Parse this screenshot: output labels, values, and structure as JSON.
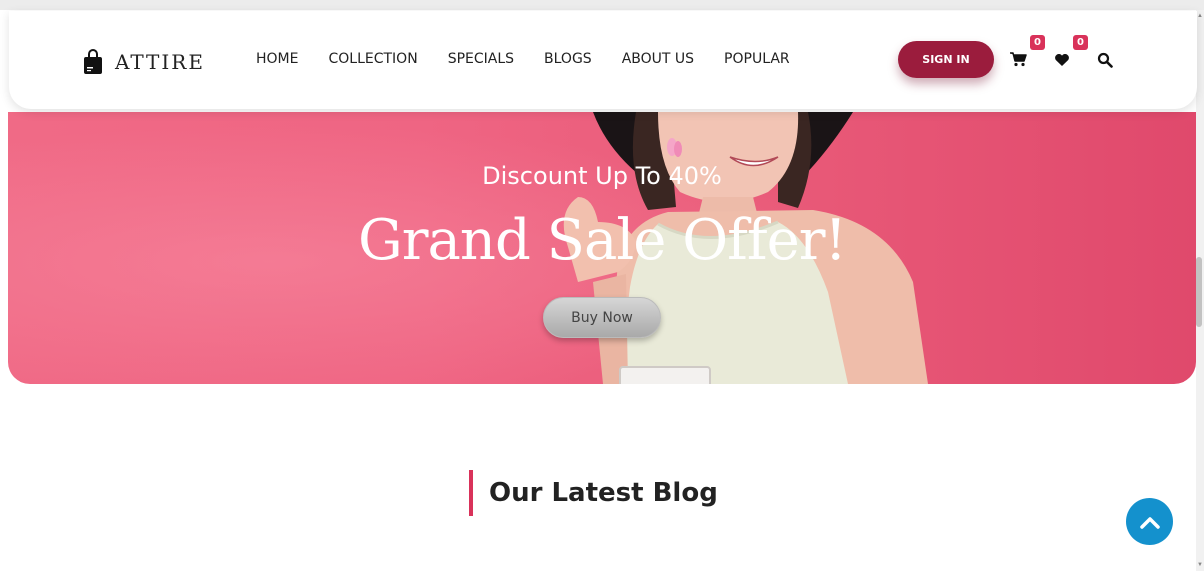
{
  "brand": {
    "name": "ATTIRE",
    "icon": "shopping-bag-icon"
  },
  "nav": {
    "links": [
      "HOME",
      "COLLECTION",
      "SPECIALS",
      "BLOGS",
      "ABOUT US",
      "POPULAR"
    ],
    "signin_label": "SIGN IN",
    "cart_count": "0",
    "wishlist_count": "0",
    "icons": [
      "cart-icon",
      "heart-icon",
      "search-icon"
    ]
  },
  "hero": {
    "subtitle": "Discount Up To 40%",
    "title": "Grand Sale Offer!",
    "button_label": "Buy Now"
  },
  "blog": {
    "heading": "Our Latest Blog"
  },
  "colors": {
    "accent": "#9b1c3d",
    "badge": "#d9325a",
    "hero_pink": "#ef6583",
    "scroll_button": "#1491cd"
  }
}
